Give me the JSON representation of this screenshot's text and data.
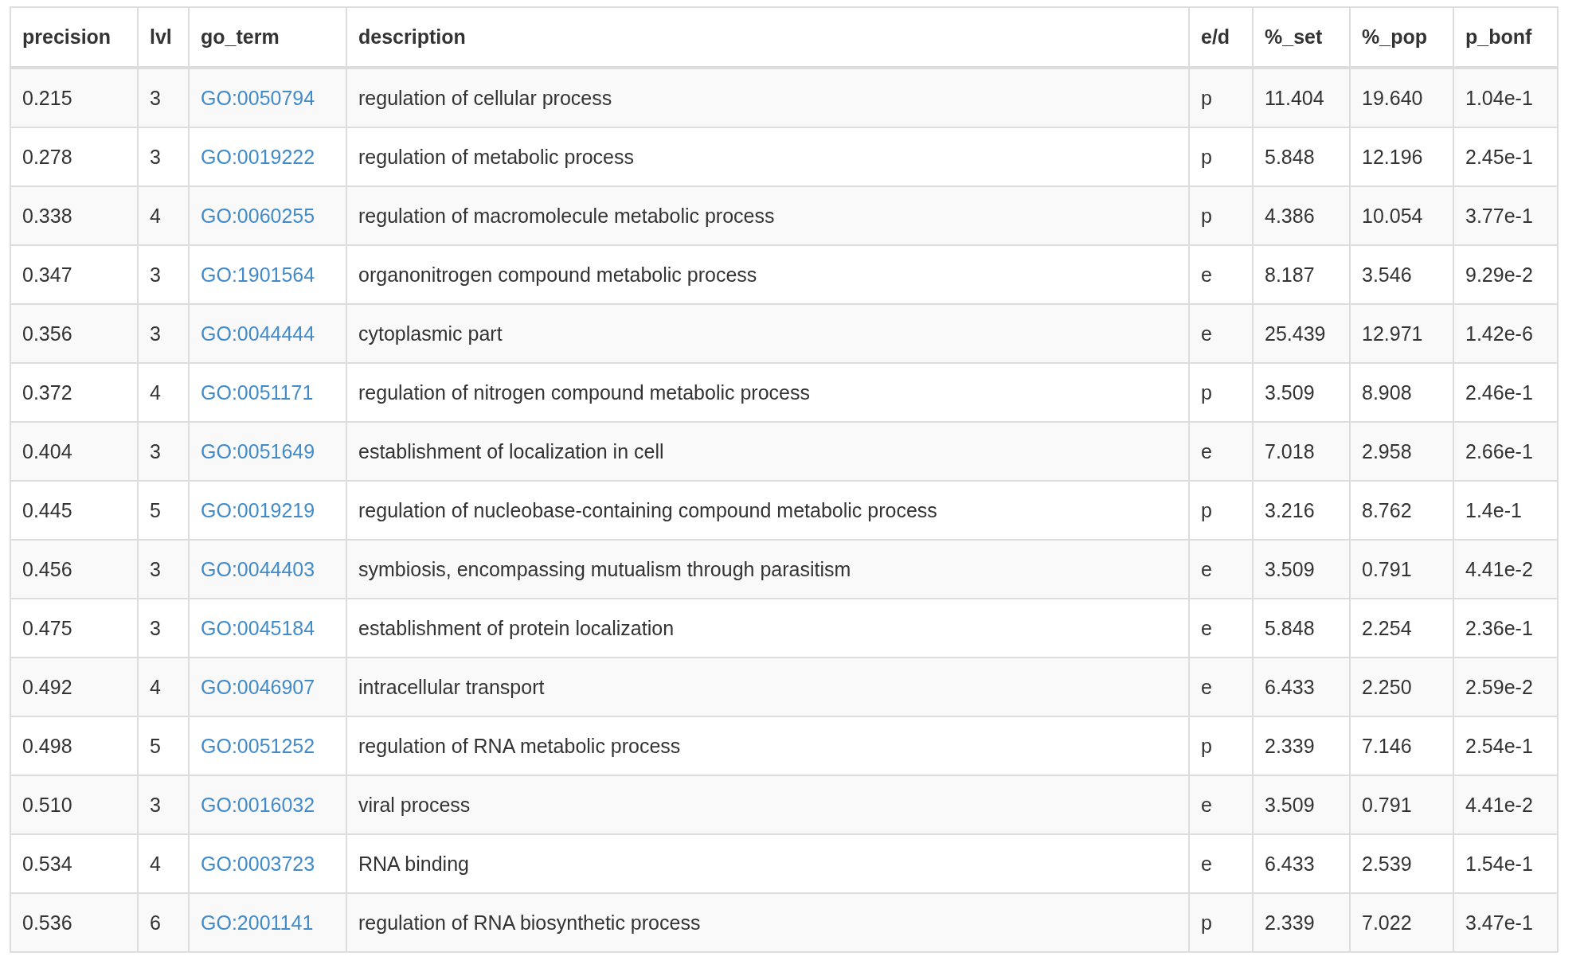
{
  "table": {
    "columns": [
      "precision",
      "lvl",
      "go_term",
      "description",
      "e/d",
      "%_set",
      "%_pop",
      "p_bonf"
    ],
    "rows": [
      [
        "0.215",
        "3",
        "GO:0050794",
        "regulation of cellular process",
        "p",
        "11.404",
        "19.640",
        "1.04e-1"
      ],
      [
        "0.278",
        "3",
        "GO:0019222",
        "regulation of metabolic process",
        "p",
        "5.848",
        "12.196",
        "2.45e-1"
      ],
      [
        "0.338",
        "4",
        "GO:0060255",
        "regulation of macromolecule metabolic process",
        "p",
        "4.386",
        "10.054",
        "3.77e-1"
      ],
      [
        "0.347",
        "3",
        "GO:1901564",
        "organonitrogen compound metabolic process",
        "e",
        "8.187",
        "3.546",
        "9.29e-2"
      ],
      [
        "0.356",
        "3",
        "GO:0044444",
        "cytoplasmic part",
        "e",
        "25.439",
        "12.971",
        "1.42e-6"
      ],
      [
        "0.372",
        "4",
        "GO:0051171",
        "regulation of nitrogen compound metabolic process",
        "p",
        "3.509",
        "8.908",
        "2.46e-1"
      ],
      [
        "0.404",
        "3",
        "GO:0051649",
        "establishment of localization in cell",
        "e",
        "7.018",
        "2.958",
        "2.66e-1"
      ],
      [
        "0.445",
        "5",
        "GO:0019219",
        "regulation of nucleobase-containing compound metabolic process",
        "p",
        "3.216",
        "8.762",
        "1.4e-1"
      ],
      [
        "0.456",
        "3",
        "GO:0044403",
        "symbiosis, encompassing mutualism through parasitism",
        "e",
        "3.509",
        "0.791",
        "4.41e-2"
      ],
      [
        "0.475",
        "3",
        "GO:0045184",
        "establishment of protein localization",
        "e",
        "5.848",
        "2.254",
        "2.36e-1"
      ],
      [
        "0.492",
        "4",
        "GO:0046907",
        "intracellular transport",
        "e",
        "6.433",
        "2.250",
        "2.59e-2"
      ],
      [
        "0.498",
        "5",
        "GO:0051252",
        "regulation of RNA metabolic process",
        "p",
        "2.339",
        "7.146",
        "2.54e-1"
      ],
      [
        "0.510",
        "3",
        "GO:0016032",
        "viral process",
        "e",
        "3.509",
        "0.791",
        "4.41e-2"
      ],
      [
        "0.534",
        "4",
        "GO:0003723",
        "RNA binding",
        "e",
        "6.433",
        "2.539",
        "1.54e-1"
      ],
      [
        "0.536",
        "6",
        "GO:2001141",
        "regulation of RNA biosynthetic process",
        "p",
        "2.339",
        "7.022",
        "3.47e-1"
      ]
    ]
  }
}
